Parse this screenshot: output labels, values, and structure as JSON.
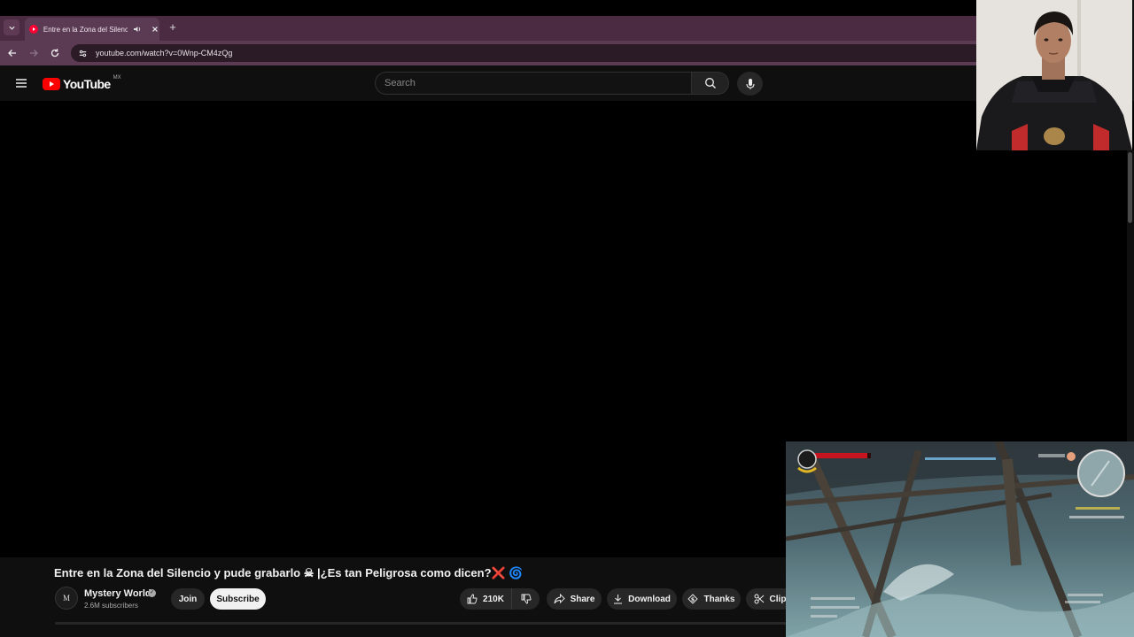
{
  "browser": {
    "tab_title": "Entre en la Zona del Silencio",
    "url": "youtube.com/watch?v=0Wnp-CM4zQg",
    "new_tab_symbol": "+"
  },
  "youtube": {
    "logo_text": "YouTube",
    "country_code": "MX",
    "search_placeholder": "Search"
  },
  "video": {
    "title": "Entre en la Zona del Silencio y pude grabarlo ☠ |¿Es tan Peligrosa como dicen?❌ 🌀",
    "channel": {
      "name": "Mystery World",
      "avatar_text": "M",
      "subscribers": "2.6M subscribers"
    },
    "actions": {
      "join": "Join",
      "subscribe": "Subscribe",
      "likes": "210K",
      "share": "Share",
      "download": "Download",
      "thanks": "Thanks",
      "clip": "Clip"
    }
  },
  "colors": {
    "tab_bar": "#4a2b41",
    "address_bar": "#5b3a53",
    "youtube_red": "#ff0000",
    "page_bg": "#0f0f0f"
  },
  "icons": [
    "tab-list-icon",
    "speaker-icon",
    "close-icon",
    "back-icon",
    "forward-icon",
    "reload-icon",
    "site-info-icon",
    "menu-icon",
    "search-icon",
    "mic-icon",
    "like-icon",
    "dislike-icon",
    "share-icon",
    "download-icon",
    "thanks-icon",
    "scissors-icon"
  ]
}
